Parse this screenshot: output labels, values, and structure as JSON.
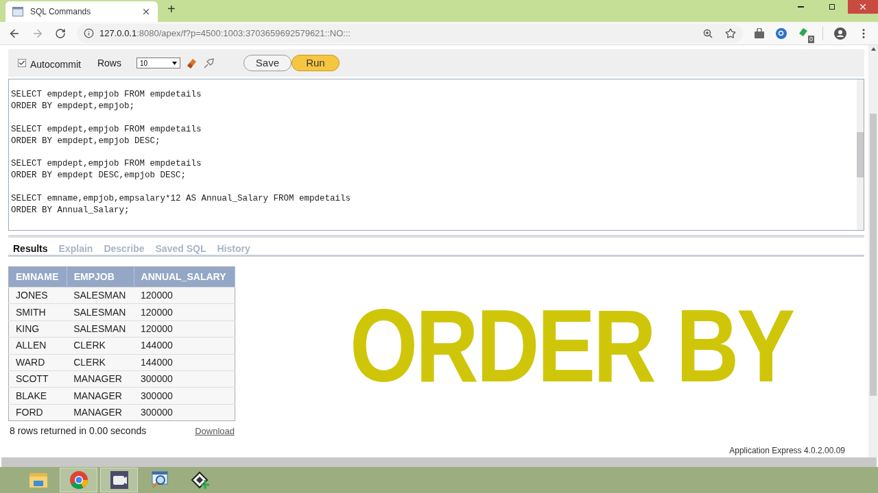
{
  "browser": {
    "tab_title": "SQL Commands",
    "new_tab": "+",
    "url_host": "127.0.0.1",
    "url_rest": ":8080/apex/f?p=4500:1003:3703659692579621::NO:::",
    "extension_badge": "0"
  },
  "toolbar": {
    "autocommit": {
      "label": "Autocommit",
      "checked": true
    },
    "rows_label": "Rows",
    "rows_value": "10",
    "buttons": [
      {
        "label": "Save",
        "kind": "plain"
      },
      {
        "label": "Run",
        "kind": "primary"
      }
    ]
  },
  "editor_statements": [
    [
      "SELECT empdept,empjob FROM empdetails",
      "ORDER BY empdept,empjob;"
    ],
    [
      "SELECT empdept,empjob FROM empdetails",
      "ORDER BY empdept,empjob DESC;"
    ],
    [
      "SELECT empdept,empjob FROM empdetails",
      "ORDER BY empdept DESC,empjob DESC;"
    ],
    [
      "SELECT emname,empjob,empsalary*12 AS Annual_Salary FROM empdetails",
      "ORDER BY Annual_Salary;"
    ]
  ],
  "result_tabs": [
    {
      "label": "Results",
      "selected": true
    },
    {
      "label": "Explain",
      "selected": false
    },
    {
      "label": "Describe",
      "selected": false
    },
    {
      "label": "Saved SQL",
      "selected": false
    },
    {
      "label": "History",
      "selected": false
    }
  ],
  "table": {
    "columns": [
      "EMNAME",
      "EMPJOB",
      "ANNUAL_SALARY"
    ],
    "rows": [
      [
        "JONES",
        "SALESMAN",
        "120000"
      ],
      [
        "SMITH",
        "SALESMAN",
        "120000"
      ],
      [
        "KING",
        "SALESMAN",
        "120000"
      ],
      [
        "ALLEN",
        "CLERK",
        "144000"
      ],
      [
        "WARD",
        "CLERK",
        "144000"
      ],
      [
        "SCOTT",
        "MANAGER",
        "300000"
      ],
      [
        "BLAKE",
        "MANAGER",
        "300000"
      ],
      [
        "FORD",
        "MANAGER",
        "300000"
      ]
    ]
  },
  "status": "8 rows returned in 0.00 seconds",
  "download": "Download",
  "footer": "Application Express 4.0.2.00.09",
  "overlay_title": "ORDER BY",
  "taskbar": [
    {
      "kind": "folder",
      "active": false
    },
    {
      "kind": "chrome",
      "active": true
    },
    {
      "kind": "recorder",
      "active": true
    },
    {
      "kind": "viewer",
      "active": false
    },
    {
      "kind": "film",
      "active": false
    }
  ]
}
